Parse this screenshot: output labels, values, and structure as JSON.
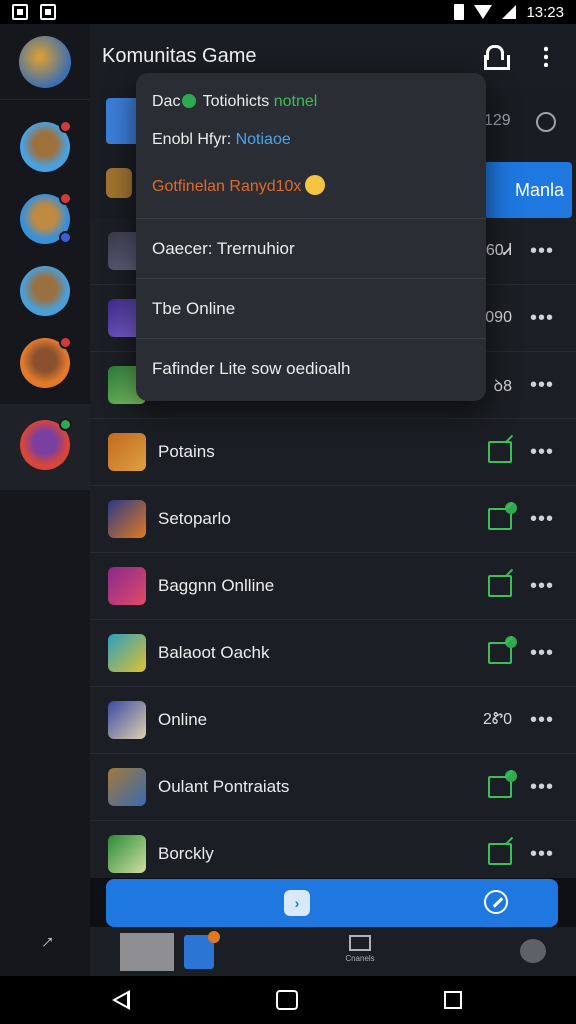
{
  "status_bar": {
    "time": "13:23"
  },
  "header": {
    "title": "Komunitas Game",
    "lock_icon": "lock-icon",
    "more_icon": "kebab-icon"
  },
  "rail": {
    "avatars": [
      {
        "name": "avatar-top",
        "colors": [
          "#3b6fb0",
          "#e0a030"
        ]
      },
      {
        "name": "avatar-1",
        "colors": [
          "#4aa0e0",
          "#a0703a"
        ],
        "badge": "red"
      },
      {
        "name": "avatar-2",
        "colors": [
          "#3a90d8",
          "#c08a40"
        ],
        "badge": "red"
      },
      {
        "name": "avatar-3",
        "colors": [
          "#4a9fd8",
          "#9a7040"
        ]
      },
      {
        "name": "avatar-4",
        "colors": [
          "#e07a2a",
          "#8a5030"
        ],
        "badge": "red"
      },
      {
        "name": "avatar-5",
        "colors": [
          "#d8453a",
          "#7a3fa0"
        ],
        "badge": "green"
      }
    ]
  },
  "top_strip": {
    "count": "129",
    "join_label": "Manla"
  },
  "rows": [
    {
      "name": "",
      "count": "60Ꮧ",
      "icon_colors": [
        "#3a3a4a",
        "#6a6a8a"
      ]
    },
    {
      "name": "",
      "count": "090",
      "icon_colors": [
        "#3a2a8a",
        "#8a6ae0"
      ]
    },
    {
      "name": "",
      "count": "ꝺ8",
      "icon_colors": [
        "#2a7a3a",
        "#8ad06a"
      ]
    },
    {
      "name": "Potains",
      "count": "",
      "edit": true,
      "icon_colors": [
        "#c06a20",
        "#e0a040"
      ]
    },
    {
      "name": "Setoparlo",
      "count": "",
      "edit": true,
      "dot": true,
      "icon_colors": [
        "#2a3a8a",
        "#e07a20"
      ]
    },
    {
      "name": "Baggnn Onlline",
      "count": "",
      "edit": true,
      "icon_colors": [
        "#8a2a8a",
        "#e04a6a"
      ]
    },
    {
      "name": "Balaoot Oachk",
      "count": "",
      "edit": true,
      "dot": true,
      "icon_colors": [
        "#2aa0c0",
        "#e0c030"
      ]
    },
    {
      "name": "Online",
      "count": "2Ꮡ0",
      "icon_colors": [
        "#3a4aa0",
        "#e0d0b0"
      ]
    },
    {
      "name": "Oulant Pontraiats",
      "count": "",
      "edit": true,
      "dot": true,
      "icon_colors": [
        "#a07a3a",
        "#3a6ab0"
      ]
    },
    {
      "name": "Borckly",
      "count": "",
      "edit": true,
      "icon_colors": [
        "#2a8a3a",
        "#d0e0a0"
      ]
    }
  ],
  "row_more": "•••",
  "popup": {
    "line1_a": "Dac",
    "line1_b": " Totiohicts ",
    "line1_c": "notnel",
    "line2_a": "Enobl Hfyr: ",
    "line2_b": "Notiaoe",
    "line3": "Gotfinelan Ranyd10x",
    "items": [
      "Oaecer: Trernuhior",
      "Tbe Online",
      "Fafinder Lite sow oedioalh"
    ]
  },
  "tabbar": {
    "channels_label": "Cnanels"
  },
  "action_bar": {
    "hex_glyph": "›"
  }
}
